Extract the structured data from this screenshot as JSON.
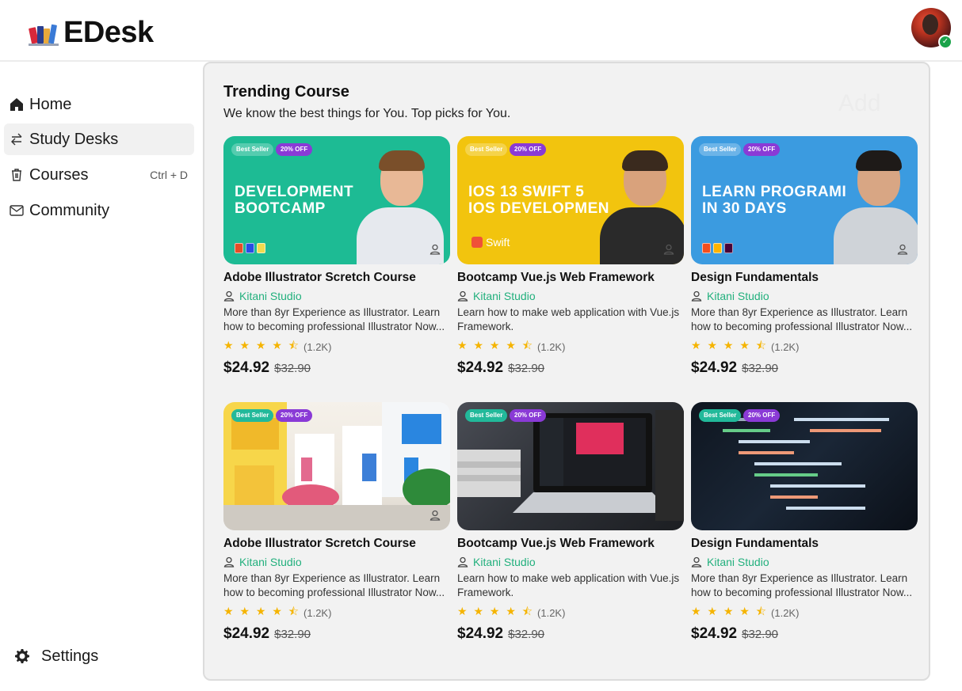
{
  "app": {
    "name": "EDesk"
  },
  "sidebar": {
    "items": [
      {
        "label": "Home",
        "icon": "home-icon",
        "active": false
      },
      {
        "label": "Study Desks",
        "icon": "swap-arrows-icon",
        "active": true
      },
      {
        "label": "Courses",
        "icon": "trash-icon",
        "active": false,
        "shortcut": "Ctrl + D"
      },
      {
        "label": "Community",
        "icon": "mail-icon",
        "active": false
      }
    ],
    "settings_label": "Settings"
  },
  "main": {
    "title": "Trending Course",
    "subtitle": "We know the best things for You.  Top picks for You.",
    "ghost_action": "Add"
  },
  "badges": {
    "best": "Best Seller",
    "off": "20% OFF"
  },
  "colors": {
    "accent_green": "#22b07d",
    "star": "#f5b400",
    "discount_badge": "#8a3ad6"
  },
  "courses": [
    {
      "title": "Adobe Illustrator Scretch Course",
      "studio": "Kitani Studio",
      "description": "More than 8yr Experience as Illustrator. Learn how to becoming professional Illustrator Now...",
      "stars": "★ ★ ★ ★ ⯪",
      "rating_count": "(1.2K)",
      "price": "$24.92",
      "old_price": "$32.90",
      "thumb_headline": "DEVELOPMENT\nBOOTCAMP"
    },
    {
      "title": "Bootcamp  Vue.js Web Framework",
      "studio": "Kitani Studio",
      "description": "Learn how to make web application with Vue.js Framework.",
      "stars": "★ ★ ★ ★ ⯪",
      "rating_count": "(1.2K)",
      "price": "$24.92",
      "old_price": "$32.90",
      "thumb_headline": "IOS 13 SWIFT 5\nIOS DEVELOPMEN",
      "thumb_tag": "Swift"
    },
    {
      "title": "Design Fundamentals",
      "studio": "Kitani Studio",
      "description": "More than 8yr Experience as Illustrator. Learn how to becoming professional Illustrator Now...",
      "stars": "★ ★ ★ ★ ⯪",
      "rating_count": "(1.2K)",
      "price": "$24.92",
      "old_price": "$32.90",
      "thumb_headline": "LEARN PROGRAMI\nIN 30 DAYS"
    },
    {
      "title": "Adobe Illustrator Scretch Course",
      "studio": "Kitani Studio",
      "description": "More than 8yr Experience as Illustrator. Learn how to becoming professional Illustrator Now...",
      "stars": "★ ★ ★ ★ ⯪",
      "rating_count": "(1.2K)",
      "price": "$24.92",
      "old_price": "$32.90"
    },
    {
      "title": "Bootcamp  Vue.js Web Framework",
      "studio": "Kitani Studio",
      "description": "Learn how to make web application with Vue.js Framework.",
      "stars": "★ ★ ★ ★ ⯪",
      "rating_count": "(1.2K)",
      "price": "$24.92",
      "old_price": "$32.90"
    },
    {
      "title": "Design Fundamentals",
      "studio": "Kitani Studio",
      "description": "More than 8yr Experience as Illustrator. Learn how to becoming professional Illustrator Now...",
      "stars": "★ ★ ★ ★ ⯪",
      "rating_count": "(1.2K)",
      "price": "$24.92",
      "old_price": "$32.90"
    }
  ]
}
